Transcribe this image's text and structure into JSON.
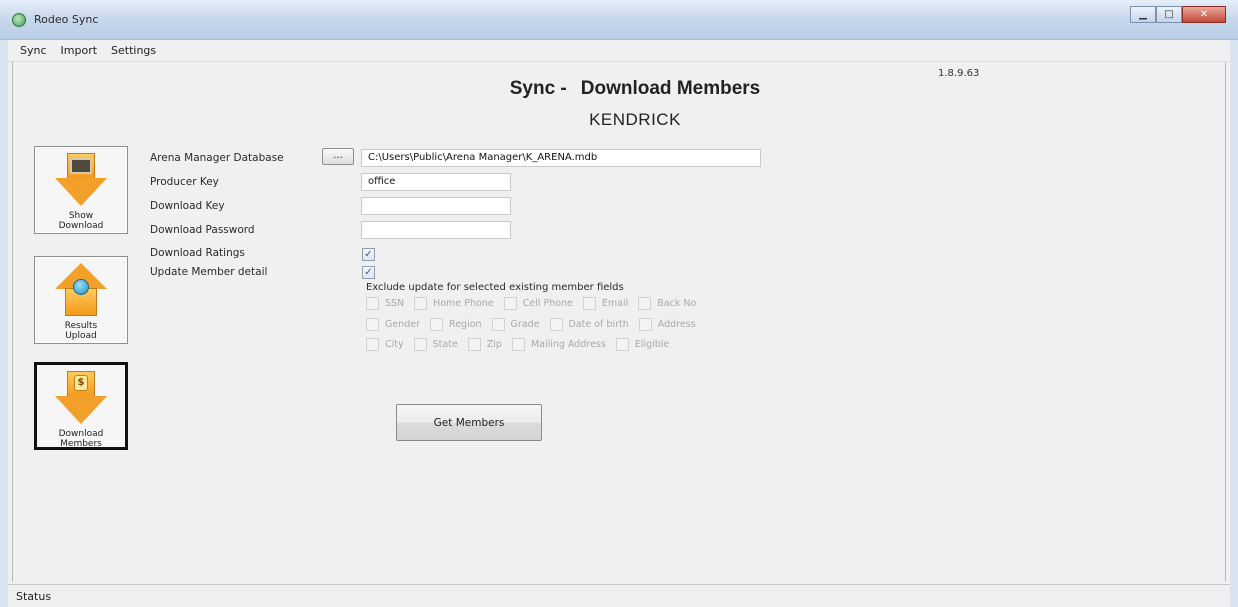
{
  "window": {
    "title": "Rodeo Sync"
  },
  "menu": [
    {
      "label": "Sync"
    },
    {
      "label": "Import"
    },
    {
      "label": "Settings"
    }
  ],
  "version": "1.8.9.63",
  "header": {
    "prefix": "Sync -",
    "title": "Download Members",
    "subtitle": "KENDRICK"
  },
  "nav": [
    {
      "label_line1": "Show",
      "label_line2": "Download",
      "icon": "arrow-down-icon",
      "active": false
    },
    {
      "label_line1": "Results",
      "label_line2": "Upload",
      "icon": "house-globe-icon",
      "active": false
    },
    {
      "label_line1": "Download",
      "label_line2": "Members",
      "icon": "download-coin-icon",
      "active": true
    }
  ],
  "form": {
    "arena_db_label": "Arena Manager Database",
    "browse_label": "...",
    "arena_db_value": "C:\\Users\\Public\\Arena Manager\\K_ARENA.mdb",
    "producer_key_label": "Producer Key",
    "producer_key_value": "office",
    "download_key_label": "Download Key",
    "download_key_value": "",
    "download_password_label": "Download Password",
    "download_password_value": "",
    "download_ratings_label": "Download Ratings",
    "download_ratings_checked": true,
    "update_member_label": "Update Member detail",
    "update_member_checked": true,
    "check_mark": "✓"
  },
  "exclude": {
    "title": "Exclude update for selected existing member fields",
    "rows": [
      [
        "SSN",
        "Home Phone",
        "Cell Phone",
        "Email",
        "Back No"
      ],
      [
        "Gender",
        "Region",
        "Grade",
        "Date of birth",
        "Address"
      ],
      [
        "City",
        "State",
        "Zip",
        "Mailing Address",
        "Eligible"
      ]
    ]
  },
  "actions": {
    "get_members": "Get Members"
  },
  "status": {
    "text": "Status"
  }
}
